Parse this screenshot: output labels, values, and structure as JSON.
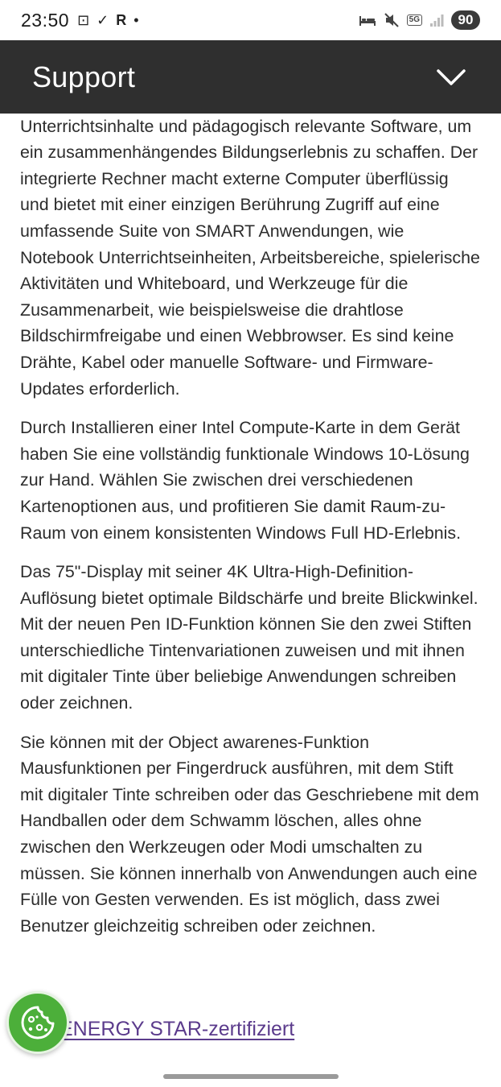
{
  "status_bar": {
    "time": "23:50",
    "left_glyphs": [
      "⊡",
      "✓",
      "R",
      "•"
    ],
    "battery": "90",
    "network_badge": "5G"
  },
  "header": {
    "title": "Support",
    "toggle_icon": "chevron-down-icon"
  },
  "article": {
    "paragraphs": [
      "Klassenraums. Die iQ-Technologie verbindet Geräte, Unterrichtsinhalte und pädagogisch relevante Software, um ein zusammenhängendes Bildungserlebnis zu schaffen. Der integrierte Rechner macht externe Computer überflüssig und bietet mit einer einzigen Berührung Zugriff auf eine umfassende Suite von SMART Anwendungen, wie Notebook Unterrichtseinheiten, Arbeitsbereiche, spielerische Aktivitäten und Whiteboard, und Werkzeuge für die Zusammenarbeit, wie beispielsweise die drahtlose Bildschirmfreigabe und einen Webbrowser. Es sind keine Drähte, Kabel oder manuelle Software- und Firmware-Updates erforderlich.",
      "Durch Installieren einer Intel Compute-Karte in dem Gerät haben Sie eine vollständig funktionale Windows 10-Lösung zur Hand. Wählen Sie zwischen drei verschiedenen Kartenoptionen aus, und profitieren Sie damit Raum-zu-Raum von einem konsistenten Windows Full HD-Erlebnis.",
      "Das 75\"-Display mit seiner 4K Ultra-High-Definition-Auflösung bietet optimale Bildschärfe und breite Blickwinkel. Mit der neuen Pen ID-Funktion können Sie den zwei Stiften unterschiedliche Tintenvariationen zuweisen und mit ihnen mit digitaler Tinte über beliebige Anwendungen schreiben oder zeichnen.",
      "Sie können mit der Object awarenes-Funktion Mausfunktionen per Fingerdruck ausführen, mit dem Stift mit digitaler Tinte schreiben oder das Geschriebene mit dem Handballen oder dem Schwamm löschen, alles ohne zwischen den Werkzeugen oder Modi umschalten zu müssen. Sie können innerhalb von Anwendungen auch eine Fülle von Gesten verwenden. Es ist möglich, dass zwei Benutzer gleichzeitig schreiben oder zeichnen."
    ],
    "link_text": "ENERGY STAR-zertifiziert"
  },
  "cookie_button": {
    "icon": "cookie-icon"
  },
  "colors": {
    "header_bg": "#2f2f2f",
    "link": "#5b3b8c",
    "cookie_green": "#4caf3a"
  }
}
